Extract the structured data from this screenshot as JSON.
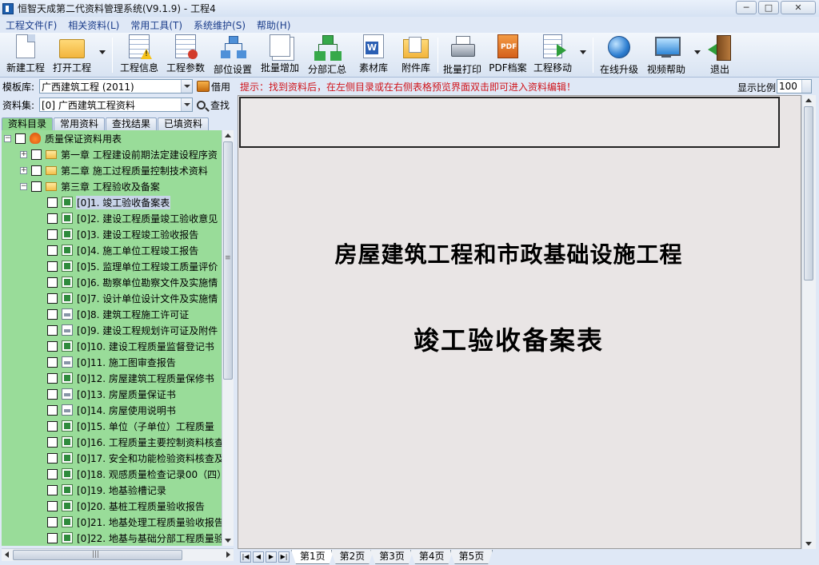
{
  "window": {
    "title": "恒智天成第二代资料管理系统(V9.1.9) - 工程4",
    "minimize": "─",
    "maximize": "□",
    "close": "✕"
  },
  "menu": [
    "工程文件(F)",
    "相关资料(L)",
    "常用工具(T)",
    "系统维护(S)",
    "帮助(H)"
  ],
  "toolbar": {
    "new_project": "新建工程",
    "open_project": "打开工程",
    "project_info": "工程信息",
    "project_params": "工程参数",
    "part_settings": "部位设置",
    "batch_add": "批量增加",
    "sub_summary": "分部汇总",
    "material_lib": "素材库",
    "attachment_lib": "附件库",
    "batch_print": "批量打印",
    "pdf_archive": "PDF档案",
    "project_move": "工程移动",
    "online_upgrade": "在线升级",
    "video_help": "视频帮助",
    "exit": "退出"
  },
  "left": {
    "template_label": "模板库:",
    "template_value": "广西建筑工程 (2011)",
    "borrow_label": "借用",
    "dataset_label": "资料集:",
    "dataset_value": "[0] 广西建筑工程资料",
    "search_label": "查找",
    "tabs": [
      "资料目录",
      "常用资料",
      "查找结果",
      "已填资料"
    ],
    "active_tab": "资料目录",
    "tree": {
      "root": "质量保证资料用表",
      "chapters": [
        "第一章 工程建设前期法定建设程序资",
        "第二章 施工过程质量控制技术资料",
        "第三章 工程验收及备案"
      ],
      "items": [
        "[0]1. 竣工验收备案表",
        "[0]2. 建设工程质量竣工验收意见",
        "[0]3. 建设工程竣工验收报告",
        "[0]4. 施工单位工程竣工报告",
        "[0]5. 监理单位工程竣工质量评价",
        "[0]6. 勘察单位勘察文件及实施情",
        "[0]7. 设计单位设计文件及实施情",
        "[0]8. 建筑工程施工许可证",
        "[0]9. 建设工程规划许可证及附件",
        "[0]10. 建设工程质量监督登记书",
        "[0]11. 施工图审查报告",
        "[0]12. 房屋建筑工程质量保修书",
        "[0]13. 房屋质量保证书",
        "[0]14. 房屋使用说明书",
        "[0]15. 单位（子单位）工程质量",
        "[0]16. 工程质量主要控制资料核查",
        "[0]17. 安全和功能检验资料核查及",
        "[0]18. 观感质量检查记录00（四）",
        "[0]19. 地基验槽记录",
        "[0]20. 基桩工程质量验收报告",
        "[0]21. 地基处理工程质量验收报告",
        "[0]22. 地基与基础分部工程质量验"
      ],
      "item_icons": [
        "xls",
        "xls",
        "xls",
        "xls",
        "xls",
        "xls",
        "xls",
        "doc",
        "doc",
        "xls",
        "doc",
        "xls",
        "doc",
        "doc",
        "xls",
        "xls",
        "xls",
        "xls",
        "xls",
        "xls",
        "xls",
        "xls"
      ]
    },
    "hscroll_grip": "|||",
    "vscroll_grip": "≡"
  },
  "right": {
    "hint": "提示：找到资料后，在左侧目录或在右侧表格预览界面双击即可进入资料编辑！",
    "zoom_label": "显示比例",
    "zoom_value": "100",
    "doc_title_line1": "房屋建筑工程和市政基础设施工程",
    "doc_title_line2": "竣工验收备案表",
    "sheet_tabs": [
      "第1页",
      "第2页",
      "第3页",
      "第4页",
      "第5页"
    ],
    "nav_buttons": [
      "|◀",
      "◀",
      "▶",
      "▶|"
    ]
  },
  "colors": {
    "tree_bg": "#99dc99",
    "hint_red": "#d0141b",
    "chrome": "#dfe8f6",
    "doc_bg": "#e9e5e5"
  }
}
